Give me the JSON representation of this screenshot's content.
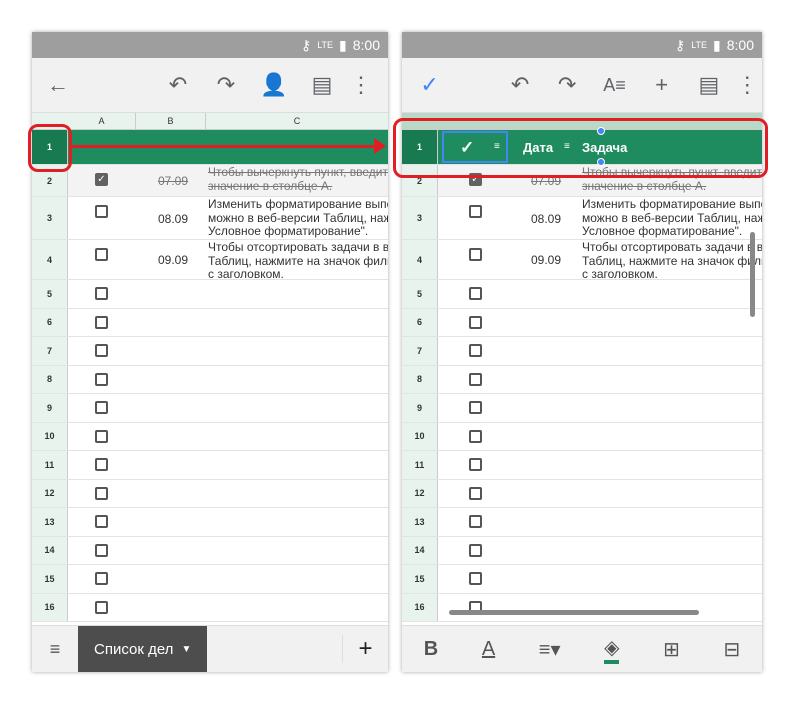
{
  "status": {
    "time": "8:00",
    "network": "LTE"
  },
  "left": {
    "columns": [
      "A",
      "B",
      "C"
    ],
    "header_row": {
      "num": "1",
      "check": "✓",
      "date": "Дата",
      "task": "Задача"
    },
    "rows": [
      {
        "num": "2",
        "checked": true,
        "date": "07.09",
        "task": "Чтобы вычеркнуть пункт, введите л\nзначение в столбце A.",
        "strike": true
      },
      {
        "num": "3",
        "checked": false,
        "date": "08.09",
        "task": "Изменить форматирование выполн\nможно в веб-версии Таблиц, нажав\nУсловное форматирование\"."
      },
      {
        "num": "4",
        "checked": false,
        "date": "09.09",
        "task": "Чтобы отсортировать задачи в веб-\nТаблиц, нажмите на значок фильтр\nс заголовком."
      },
      {
        "num": "5"
      },
      {
        "num": "6"
      },
      {
        "num": "7"
      },
      {
        "num": "8"
      },
      {
        "num": "9"
      },
      {
        "num": "10"
      },
      {
        "num": "11"
      },
      {
        "num": "12"
      },
      {
        "num": "13"
      },
      {
        "num": "14"
      },
      {
        "num": "15"
      },
      {
        "num": "16"
      }
    ],
    "sheet_tab": "Список дел",
    "add_sheet": "+"
  },
  "right": {
    "header_row": {
      "num": "1",
      "check": "✓",
      "date": "Дата",
      "task": "Задача"
    },
    "format_bold": "B",
    "format_color": "A"
  },
  "colors": {
    "header_green": "#1e8c5f",
    "highlight_red": "#e01e24",
    "selection_blue": "#4285f4"
  }
}
